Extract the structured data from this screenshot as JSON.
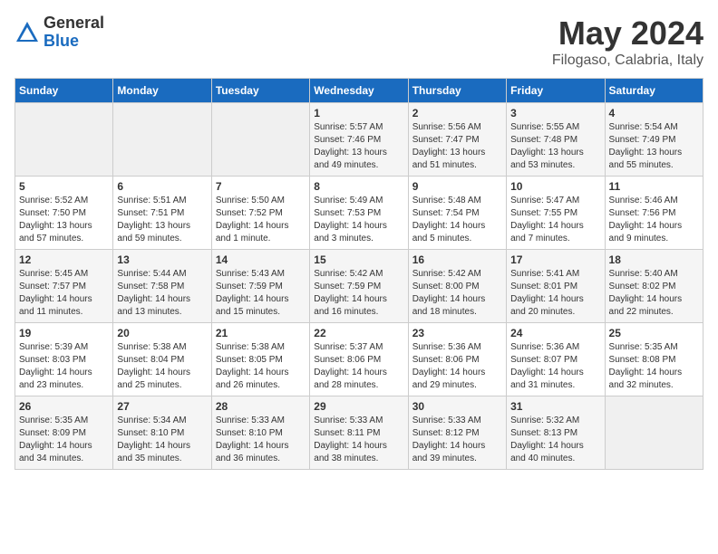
{
  "logo": {
    "general": "General",
    "blue": "Blue"
  },
  "header": {
    "month": "May 2024",
    "location": "Filogaso, Calabria, Italy"
  },
  "weekdays": [
    "Sunday",
    "Monday",
    "Tuesday",
    "Wednesday",
    "Thursday",
    "Friday",
    "Saturday"
  ],
  "weeks": [
    [
      {
        "day": "",
        "info": ""
      },
      {
        "day": "",
        "info": ""
      },
      {
        "day": "",
        "info": ""
      },
      {
        "day": "1",
        "info": "Sunrise: 5:57 AM\nSunset: 7:46 PM\nDaylight: 13 hours\nand 49 minutes."
      },
      {
        "day": "2",
        "info": "Sunrise: 5:56 AM\nSunset: 7:47 PM\nDaylight: 13 hours\nand 51 minutes."
      },
      {
        "day": "3",
        "info": "Sunrise: 5:55 AM\nSunset: 7:48 PM\nDaylight: 13 hours\nand 53 minutes."
      },
      {
        "day": "4",
        "info": "Sunrise: 5:54 AM\nSunset: 7:49 PM\nDaylight: 13 hours\nand 55 minutes."
      }
    ],
    [
      {
        "day": "5",
        "info": "Sunrise: 5:52 AM\nSunset: 7:50 PM\nDaylight: 13 hours\nand 57 minutes."
      },
      {
        "day": "6",
        "info": "Sunrise: 5:51 AM\nSunset: 7:51 PM\nDaylight: 13 hours\nand 59 minutes."
      },
      {
        "day": "7",
        "info": "Sunrise: 5:50 AM\nSunset: 7:52 PM\nDaylight: 14 hours\nand 1 minute."
      },
      {
        "day": "8",
        "info": "Sunrise: 5:49 AM\nSunset: 7:53 PM\nDaylight: 14 hours\nand 3 minutes."
      },
      {
        "day": "9",
        "info": "Sunrise: 5:48 AM\nSunset: 7:54 PM\nDaylight: 14 hours\nand 5 minutes."
      },
      {
        "day": "10",
        "info": "Sunrise: 5:47 AM\nSunset: 7:55 PM\nDaylight: 14 hours\nand 7 minutes."
      },
      {
        "day": "11",
        "info": "Sunrise: 5:46 AM\nSunset: 7:56 PM\nDaylight: 14 hours\nand 9 minutes."
      }
    ],
    [
      {
        "day": "12",
        "info": "Sunrise: 5:45 AM\nSunset: 7:57 PM\nDaylight: 14 hours\nand 11 minutes."
      },
      {
        "day": "13",
        "info": "Sunrise: 5:44 AM\nSunset: 7:58 PM\nDaylight: 14 hours\nand 13 minutes."
      },
      {
        "day": "14",
        "info": "Sunrise: 5:43 AM\nSunset: 7:59 PM\nDaylight: 14 hours\nand 15 minutes."
      },
      {
        "day": "15",
        "info": "Sunrise: 5:42 AM\nSunset: 7:59 PM\nDaylight: 14 hours\nand 16 minutes."
      },
      {
        "day": "16",
        "info": "Sunrise: 5:42 AM\nSunset: 8:00 PM\nDaylight: 14 hours\nand 18 minutes."
      },
      {
        "day": "17",
        "info": "Sunrise: 5:41 AM\nSunset: 8:01 PM\nDaylight: 14 hours\nand 20 minutes."
      },
      {
        "day": "18",
        "info": "Sunrise: 5:40 AM\nSunset: 8:02 PM\nDaylight: 14 hours\nand 22 minutes."
      }
    ],
    [
      {
        "day": "19",
        "info": "Sunrise: 5:39 AM\nSunset: 8:03 PM\nDaylight: 14 hours\nand 23 minutes."
      },
      {
        "day": "20",
        "info": "Sunrise: 5:38 AM\nSunset: 8:04 PM\nDaylight: 14 hours\nand 25 minutes."
      },
      {
        "day": "21",
        "info": "Sunrise: 5:38 AM\nSunset: 8:05 PM\nDaylight: 14 hours\nand 26 minutes."
      },
      {
        "day": "22",
        "info": "Sunrise: 5:37 AM\nSunset: 8:06 PM\nDaylight: 14 hours\nand 28 minutes."
      },
      {
        "day": "23",
        "info": "Sunrise: 5:36 AM\nSunset: 8:06 PM\nDaylight: 14 hours\nand 29 minutes."
      },
      {
        "day": "24",
        "info": "Sunrise: 5:36 AM\nSunset: 8:07 PM\nDaylight: 14 hours\nand 31 minutes."
      },
      {
        "day": "25",
        "info": "Sunrise: 5:35 AM\nSunset: 8:08 PM\nDaylight: 14 hours\nand 32 minutes."
      }
    ],
    [
      {
        "day": "26",
        "info": "Sunrise: 5:35 AM\nSunset: 8:09 PM\nDaylight: 14 hours\nand 34 minutes."
      },
      {
        "day": "27",
        "info": "Sunrise: 5:34 AM\nSunset: 8:10 PM\nDaylight: 14 hours\nand 35 minutes."
      },
      {
        "day": "28",
        "info": "Sunrise: 5:33 AM\nSunset: 8:10 PM\nDaylight: 14 hours\nand 36 minutes."
      },
      {
        "day": "29",
        "info": "Sunrise: 5:33 AM\nSunset: 8:11 PM\nDaylight: 14 hours\nand 38 minutes."
      },
      {
        "day": "30",
        "info": "Sunrise: 5:33 AM\nSunset: 8:12 PM\nDaylight: 14 hours\nand 39 minutes."
      },
      {
        "day": "31",
        "info": "Sunrise: 5:32 AM\nSunset: 8:13 PM\nDaylight: 14 hours\nand 40 minutes."
      },
      {
        "day": "",
        "info": ""
      }
    ]
  ]
}
